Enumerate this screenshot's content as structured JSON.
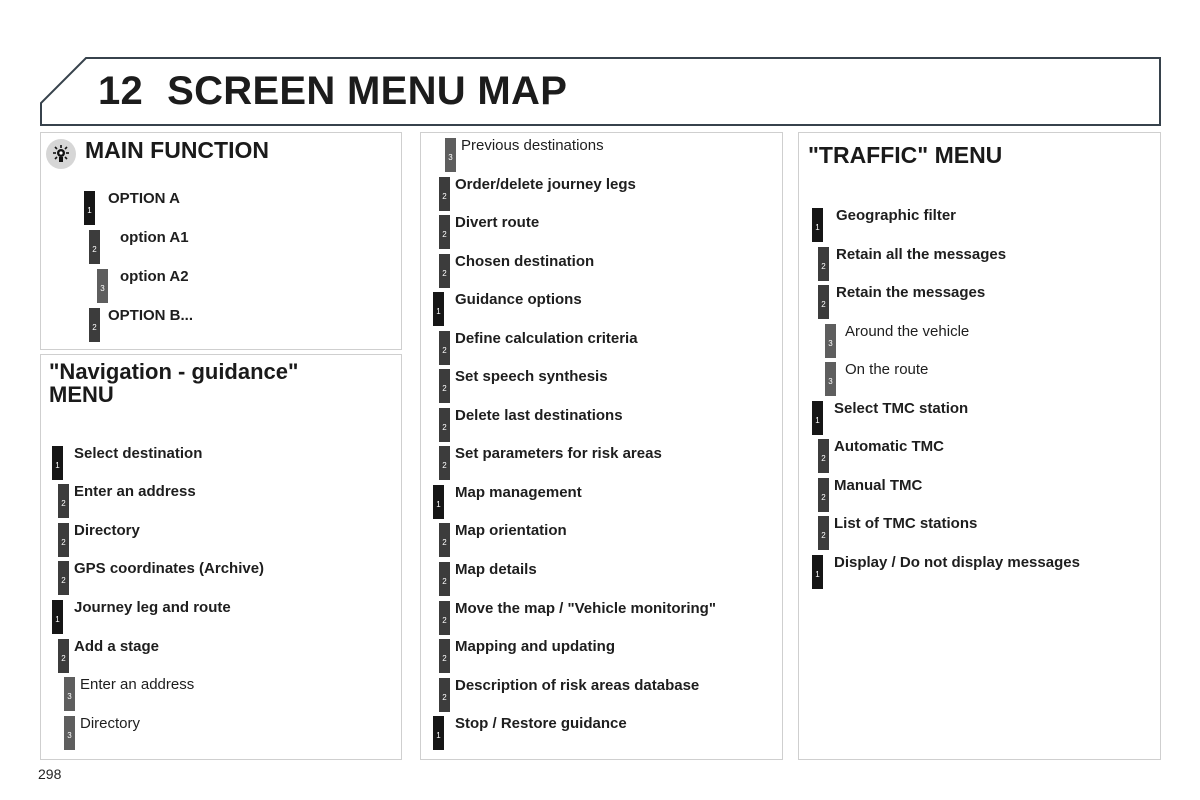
{
  "header": {
    "chapter_number": "12",
    "title": "SCREEN MENU MAP"
  },
  "page_number": "298",
  "main_function": {
    "icon": "main-function-icon",
    "title": "MAIN FUNCTION",
    "items": [
      {
        "level": "1",
        "label": "OPTION A"
      },
      {
        "level": "2",
        "label": "option A1"
      },
      {
        "level": "3",
        "label": "option A2"
      },
      {
        "level": "2",
        "label": "OPTION B..."
      }
    ]
  },
  "navigation_menu": {
    "title_line1": "\"Navigation - guidance\"",
    "title_line2": "MENU",
    "items": [
      {
        "level": "1",
        "label": "Select destination"
      },
      {
        "level": "2",
        "label": "Enter an address"
      },
      {
        "level": "2",
        "label": "Directory"
      },
      {
        "level": "2",
        "label": "GPS coordinates (Archive)"
      },
      {
        "level": "1",
        "label": "Journey leg and route"
      },
      {
        "level": "2",
        "label": "Add a stage"
      },
      {
        "level": "3",
        "label": "Enter an address"
      },
      {
        "level": "3",
        "label": "Directory"
      }
    ]
  },
  "navigation_continued": {
    "items": [
      {
        "level": "3",
        "label": "Previous destinations"
      },
      {
        "level": "2",
        "label": "Order/delete journey legs"
      },
      {
        "level": "2",
        "label": "Divert route"
      },
      {
        "level": "2",
        "label": "Chosen destination"
      },
      {
        "level": "1",
        "label": "Guidance options"
      },
      {
        "level": "2",
        "label": "Define calculation criteria"
      },
      {
        "level": "2",
        "label": "Set speech synthesis"
      },
      {
        "level": "2",
        "label": "Delete last destinations"
      },
      {
        "level": "2",
        "label": "Set parameters for risk areas"
      },
      {
        "level": "1",
        "label": "Map management"
      },
      {
        "level": "2",
        "label": "Map orientation"
      },
      {
        "level": "2",
        "label": "Map details"
      },
      {
        "level": "2",
        "label": "Move the map / \"Vehicle monitoring\""
      },
      {
        "level": "2",
        "label": "Mapping and updating"
      },
      {
        "level": "2",
        "label": "Description of risk areas database"
      },
      {
        "level": "1",
        "label": "Stop / Restore guidance"
      }
    ]
  },
  "traffic_menu": {
    "title": "\"TRAFFIC\" MENU",
    "items": [
      {
        "level": "1",
        "label": "Geographic filter"
      },
      {
        "level": "2",
        "label": "Retain all the messages"
      },
      {
        "level": "2",
        "label": "Retain the messages"
      },
      {
        "level": "3",
        "label": "Around the vehicle"
      },
      {
        "level": "3",
        "label": "On the route"
      },
      {
        "level": "1",
        "label": "Select TMC station"
      },
      {
        "level": "2",
        "label": "Automatic TMC"
      },
      {
        "level": "2",
        "label": "Manual TMC"
      },
      {
        "level": "2",
        "label": "List of TMC stations"
      },
      {
        "level": "1",
        "label": "Display / Do not display messages"
      }
    ]
  }
}
